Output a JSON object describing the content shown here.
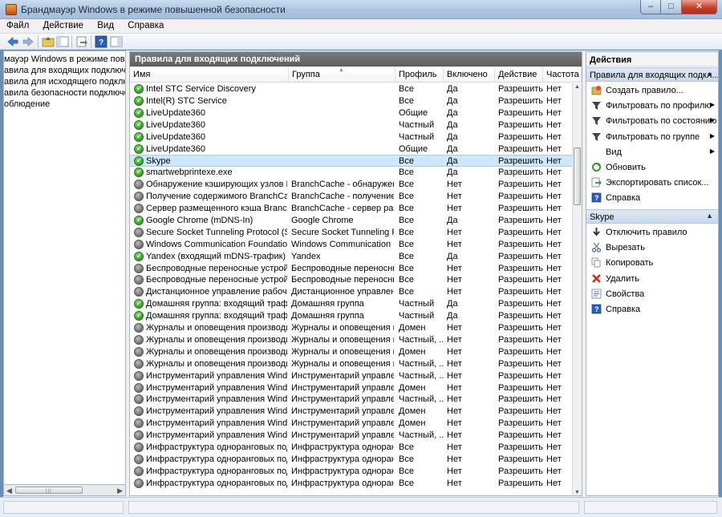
{
  "window": {
    "title": "Брандмауэр Windows в режиме повышенной безопасности"
  },
  "menu": [
    {
      "label": "Файл"
    },
    {
      "label": "Действие"
    },
    {
      "label": "Вид"
    },
    {
      "label": "Справка"
    }
  ],
  "tree": [
    {
      "label": "мауэр Windows в режиме повышеі"
    },
    {
      "label": "авила для входящих подключений"
    },
    {
      "label": "авила для исходящего подключе"
    },
    {
      "label": "авила безопасности подключения"
    },
    {
      "label": "облюдение"
    }
  ],
  "center": {
    "header": "Правила для входящих подключений",
    "columns": [
      "Имя",
      "Группа",
      "Профиль",
      "Включено",
      "Действие",
      "Частота"
    ],
    "rows": [
      {
        "name": "Intel STC Service Discovery",
        "group": "",
        "profile": "Все",
        "enabled": "Да",
        "action": "Разрешить",
        "freq": "Нет",
        "on": true
      },
      {
        "name": "Intel(R) STC Service",
        "group": "",
        "profile": "Все",
        "enabled": "Да",
        "action": "Разрешить",
        "freq": "Нет",
        "on": true
      },
      {
        "name": "LiveUpdate360",
        "group": "",
        "profile": "Общие",
        "enabled": "Да",
        "action": "Разрешить",
        "freq": "Нет",
        "on": true
      },
      {
        "name": "LiveUpdate360",
        "group": "",
        "profile": "Частный",
        "enabled": "Да",
        "action": "Разрешить",
        "freq": "Нет",
        "on": true
      },
      {
        "name": "LiveUpdate360",
        "group": "",
        "profile": "Частный",
        "enabled": "Да",
        "action": "Разрешить",
        "freq": "Нет",
        "on": true
      },
      {
        "name": "LiveUpdate360",
        "group": "",
        "profile": "Общие",
        "enabled": "Да",
        "action": "Разрешить",
        "freq": "Нет",
        "on": true
      },
      {
        "name": "Skype",
        "group": "",
        "profile": "Все",
        "enabled": "Да",
        "action": "Разрешить",
        "freq": "Нет",
        "on": true,
        "selected": true
      },
      {
        "name": "smartwebprintexe.exe",
        "group": "",
        "profile": "Все",
        "enabled": "Да",
        "action": "Разрешить",
        "freq": "Нет",
        "on": true
      },
      {
        "name": "Обнаружение кэширующих узлов Branch...",
        "group": "BranchCache - обнаружен...",
        "profile": "Все",
        "enabled": "Нет",
        "action": "Разрешить",
        "freq": "Нет",
        "on": false
      },
      {
        "name": "Получение содержимого BranchCache ...",
        "group": "BranchCache - получение ...",
        "profile": "Все",
        "enabled": "Нет",
        "action": "Разрешить",
        "freq": "Нет",
        "on": false
      },
      {
        "name": "Сервер размещенного кэша BranchCa...",
        "group": "BranchCache - сервер разм...",
        "profile": "Все",
        "enabled": "Нет",
        "action": "Разрешить",
        "freq": "Нет",
        "on": false
      },
      {
        "name": "Google Chrome (mDNS-In)",
        "group": "Google Chrome",
        "profile": "Все",
        "enabled": "Да",
        "action": "Разрешить",
        "freq": "Нет",
        "on": true
      },
      {
        "name": "Secure Socket Tunneling Protocol (SSTP-...",
        "group": "Secure Socket Tunneling P...",
        "profile": "Все",
        "enabled": "Нет",
        "action": "Разрешить",
        "freq": "Нет",
        "on": false
      },
      {
        "name": "Windows Communication Foundation N...",
        "group": "Windows Communication F...",
        "profile": "Все",
        "enabled": "Нет",
        "action": "Разрешить",
        "freq": "Нет",
        "on": false
      },
      {
        "name": "Yandex (входящий mDNS-трафик)",
        "group": "Yandex",
        "profile": "Все",
        "enabled": "Да",
        "action": "Разрешить",
        "freq": "Нет",
        "on": true
      },
      {
        "name": "Беспроводные переносные устройства...",
        "group": "Беспроводные переносны...",
        "profile": "Все",
        "enabled": "Нет",
        "action": "Разрешить",
        "freq": "Нет",
        "on": false
      },
      {
        "name": "Беспроводные переносные устройства...",
        "group": "Беспроводные переносны...",
        "profile": "Все",
        "enabled": "Нет",
        "action": "Разрешить",
        "freq": "Нет",
        "on": false
      },
      {
        "name": "Дистанционное управление рабочим с...",
        "group": "Дистанционное управлен...",
        "profile": "Все",
        "enabled": "Нет",
        "action": "Разрешить",
        "freq": "Нет",
        "on": false
      },
      {
        "name": "Домашняя группа: входящий трафик",
        "group": "Домашняя группа",
        "profile": "Частный",
        "enabled": "Да",
        "action": "Разрешить",
        "freq": "Нет",
        "on": true
      },
      {
        "name": "Домашняя группа: входящий трафик (...",
        "group": "Домашняя группа",
        "profile": "Частный",
        "enabled": "Да",
        "action": "Разрешить",
        "freq": "Нет",
        "on": true
      },
      {
        "name": "Журналы и оповещения производител...",
        "group": "Журналы и оповещения п...",
        "profile": "Домен",
        "enabled": "Нет",
        "action": "Разрешить",
        "freq": "Нет",
        "on": false
      },
      {
        "name": "Журналы и оповещения производител...",
        "group": "Журналы и оповещения п...",
        "profile": "Частный, ...",
        "enabled": "Нет",
        "action": "Разрешить",
        "freq": "Нет",
        "on": false
      },
      {
        "name": "Журналы и оповещения производител...",
        "group": "Журналы и оповещения п...",
        "profile": "Домен",
        "enabled": "Нет",
        "action": "Разрешить",
        "freq": "Нет",
        "on": false
      },
      {
        "name": "Журналы и оповещения производител...",
        "group": "Журналы и оповещения п...",
        "profile": "Частный, ...",
        "enabled": "Нет",
        "action": "Разрешить",
        "freq": "Нет",
        "on": false
      },
      {
        "name": "Инструментарий управления Windows ...",
        "group": "Инструментарий управлен...",
        "profile": "Частный, ...",
        "enabled": "Нет",
        "action": "Разрешить",
        "freq": "Нет",
        "on": false
      },
      {
        "name": "Инструментарий управления Windows ...",
        "group": "Инструментарий управлен...",
        "profile": "Домен",
        "enabled": "Нет",
        "action": "Разрешить",
        "freq": "Нет",
        "on": false
      },
      {
        "name": "Инструментарий управления Windows ...",
        "group": "Инструментарий управлен...",
        "profile": "Частный, ...",
        "enabled": "Нет",
        "action": "Разрешить",
        "freq": "Нет",
        "on": false
      },
      {
        "name": "Инструментарий управления Windows ...",
        "group": "Инструментарий управлен...",
        "profile": "Домен",
        "enabled": "Нет",
        "action": "Разрешить",
        "freq": "Нет",
        "on": false
      },
      {
        "name": "Инструментарий управления Windows ...",
        "group": "Инструментарий управлен...",
        "profile": "Домен",
        "enabled": "Нет",
        "action": "Разрешить",
        "freq": "Нет",
        "on": false
      },
      {
        "name": "Инструментарий управления Windows ...",
        "group": "Инструментарий управлен...",
        "profile": "Частный, ...",
        "enabled": "Нет",
        "action": "Разрешить",
        "freq": "Нет",
        "on": false
      },
      {
        "name": "Инфраструктура одноранговых подкл...",
        "group": "Инфраструктура одноранг...",
        "profile": "Все",
        "enabled": "Нет",
        "action": "Разрешить",
        "freq": "Нет",
        "on": false
      },
      {
        "name": "Инфраструктура одноранговых подкл...",
        "group": "Инфраструктура одноранг...",
        "profile": "Все",
        "enabled": "Нет",
        "action": "Разрешить",
        "freq": "Нет",
        "on": false
      },
      {
        "name": "Инфраструктура одноранговых подкл...",
        "group": "Инфраструктура одноранг...",
        "profile": "Все",
        "enabled": "Нет",
        "action": "Разрешить",
        "freq": "Нет",
        "on": false
      },
      {
        "name": "Инфраструктура одноранговых подкл...",
        "group": "Инфраструктура одноранг...",
        "profile": "Все",
        "enabled": "Нет",
        "action": "Разрешить",
        "freq": "Нет",
        "on": false
      }
    ]
  },
  "actions": {
    "title": "Действия",
    "section1": "Правила для входящих подкл...",
    "items1": [
      {
        "label": "Создать правило...",
        "icon": "new-rule-icon"
      },
      {
        "label": "Фильтровать по профилю",
        "icon": "filter-icon",
        "submenu": true
      },
      {
        "label": "Фильтровать по состоянию",
        "icon": "filter-icon",
        "submenu": true
      },
      {
        "label": "Фильтровать по группе",
        "icon": "filter-icon",
        "submenu": true
      },
      {
        "label": "Вид",
        "icon": "",
        "submenu": true
      },
      {
        "label": "Обновить",
        "icon": "refresh-icon"
      },
      {
        "label": "Экспортировать список...",
        "icon": "export-icon"
      },
      {
        "label": "Справка",
        "icon": "help-icon"
      }
    ],
    "section2": "Skype",
    "items2": [
      {
        "label": "Отключить правило",
        "icon": "disable-rule-icon"
      },
      {
        "label": "Вырезать",
        "icon": "cut-icon"
      },
      {
        "label": "Копировать",
        "icon": "copy-icon"
      },
      {
        "label": "Удалить",
        "icon": "delete-icon"
      },
      {
        "label": "Свойства",
        "icon": "properties-icon"
      },
      {
        "label": "Справка",
        "icon": "help-icon"
      }
    ]
  }
}
